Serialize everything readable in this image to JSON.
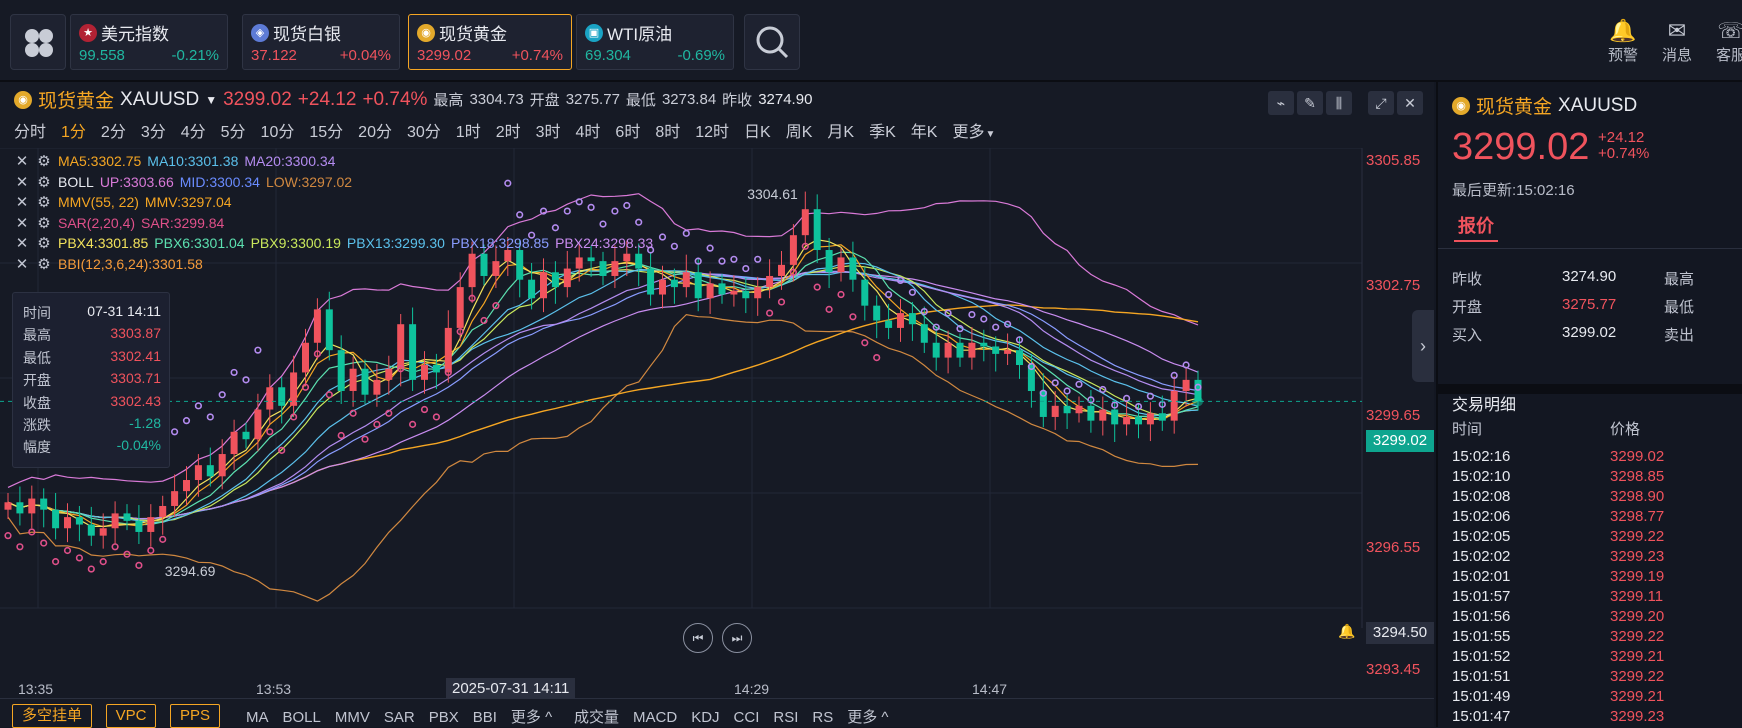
{
  "topbar": {
    "tiles": [
      {
        "name": "美元指数",
        "price": "99.558",
        "change": "-0.21%",
        "dir": "dn",
        "icon": "us-flag-icon"
      },
      {
        "name": "现货白银",
        "price": "37.122",
        "change": "+0.04%",
        "dir": "up",
        "icon": "silver-icon"
      },
      {
        "name": "现货黄金",
        "price": "3299.02",
        "change": "+0.74%",
        "dir": "up",
        "icon": "gold-icon"
      },
      {
        "name": "WTI原油",
        "price": "69.304",
        "change": "-0.69%",
        "dir": "dn",
        "icon": "oil-icon"
      }
    ],
    "tools": [
      {
        "label": "预警"
      },
      {
        "label": "消息"
      },
      {
        "label": "客服"
      }
    ]
  },
  "symbol": {
    "name": "现货黄金",
    "code": "XAUUSD",
    "price": "3299.02",
    "change": "+24.12",
    "pct": "+0.74%",
    "high_label": "最高",
    "high": "3304.73",
    "open_label": "开盘",
    "open": "3275.77",
    "low_label": "最低",
    "low": "3273.84",
    "prev_label": "昨收",
    "prev": "3274.90"
  },
  "periods": [
    "分时",
    "1分",
    "2分",
    "3分",
    "4分",
    "5分",
    "10分",
    "15分",
    "20分",
    "30分",
    "1时",
    "2时",
    "3时",
    "4时",
    "6时",
    "8时",
    "12时",
    "日K",
    "周K",
    "月K",
    "季K",
    "年K",
    "更多"
  ],
  "active_period": "1分",
  "indicators": [
    [
      {
        "t": "MA5:3302.75",
        "c": "#f5a623"
      },
      {
        "t": "MA10:3301.38",
        "c": "#5bc0eb"
      },
      {
        "t": "MA20:3300.34",
        "c": "#b48cf0"
      }
    ],
    [
      {
        "t": "BOLL",
        "c": "#e8eaf0"
      },
      {
        "t": "UP:3303.66",
        "c": "#d97ad8"
      },
      {
        "t": "MID:3300.34",
        "c": "#6a8cff"
      },
      {
        "t": "LOW:3297.02",
        "c": "#d08840"
      }
    ],
    [
      {
        "t": "MMV(55, 22)",
        "c": "#f5a623"
      },
      {
        "t": "MMV:3297.04",
        "c": "#f5a623"
      }
    ],
    [
      {
        "t": "SAR(2,20,4)",
        "c": "#e0508a"
      },
      {
        "t": "SAR:3299.84",
        "c": "#e0508a"
      }
    ],
    [
      {
        "t": "PBX4:3301.85",
        "c": "#f2e25c"
      },
      {
        "t": "PBX6:3301.04",
        "c": "#5ce0b0"
      },
      {
        "t": "PBX9:3300.19",
        "c": "#c9e85c"
      },
      {
        "t": "PBX13:3299.30",
        "c": "#5bc0eb"
      },
      {
        "t": "PBX18:3298.85",
        "c": "#8a9cff"
      },
      {
        "t": "PBX24:3298.33",
        "c": "#c98cf0"
      }
    ],
    [
      {
        "t": "BBI(12,3,6,24):3301.58",
        "c": "#f59b3a"
      }
    ]
  ],
  "tooltip": {
    "rows": [
      {
        "k": "时间",
        "v": "07-31 14:11",
        "c": "#e8eaf0"
      },
      {
        "k": "最高",
        "v": "3303.87",
        "c": "#f0535d"
      },
      {
        "k": "最低",
        "v": "3302.41",
        "c": "#f0535d"
      },
      {
        "k": "开盘",
        "v": "3303.71",
        "c": "#f0535d"
      },
      {
        "k": "收盘",
        "v": "3302.43",
        "c": "#f0535d"
      },
      {
        "k": "涨跌",
        "v": "-1.28",
        "c": "#20b7a1"
      },
      {
        "k": "幅度",
        "v": "-0.04%",
        "c": "#20b7a1"
      }
    ]
  },
  "chart_data": {
    "type": "candlestick",
    "y_ticks": [
      "3305.85",
      "3302.75",
      "3299.65",
      "3296.55",
      "3293.45"
    ],
    "ylim": [
      3293.45,
      3305.85
    ],
    "x_ticks": [
      "13:35",
      "13:53",
      "14:29",
      "14:47"
    ],
    "crosshair_x_label": "2025-07-31 14:11",
    "current_price": "3299.02",
    "crosshair_y_label": "3294.50",
    "high_annotation": "3304.61",
    "low_annotation": "3294.69",
    "close_path": [
      3296.3,
      3296.0,
      3296.4,
      3296.1,
      3295.6,
      3295.9,
      3295.7,
      3295.4,
      3295.6,
      3296.0,
      3295.8,
      3295.5,
      3295.9,
      3296.2,
      3296.6,
      3296.9,
      3297.3,
      3297.0,
      3297.6,
      3298.2,
      3298.0,
      3298.8,
      3299.4,
      3298.9,
      3299.8,
      3300.6,
      3301.5,
      3300.4,
      3299.3,
      3299.9,
      3299.2,
      3299.6,
      3299.9,
      3301.1,
      3299.6,
      3300.0,
      3299.8,
      3301.0,
      3302.1,
      3303.0,
      3302.4,
      3302.8,
      3303.1,
      3302.3,
      3301.8,
      3302.5,
      3302.1,
      3302.6,
      3302.9,
      3302.8,
      3302.4,
      3302.8,
      3303.0,
      3302.6,
      3301.9,
      3302.3,
      3302.1,
      3302.5,
      3301.8,
      3302.2,
      3301.9,
      3302.0,
      3301.8,
      3302.1,
      3302.4,
      3302.7,
      3303.5,
      3304.2,
      3303.1,
      3302.5,
      3302.9,
      3302.3,
      3301.6,
      3301.2,
      3301.0,
      3301.4,
      3301.1,
      3300.6,
      3300.2,
      3300.6,
      3300.2,
      3300.6,
      3300.5,
      3300.3,
      3300.4,
      3300.0,
      3299.3,
      3298.6,
      3298.9,
      3298.7,
      3298.9,
      3298.5,
      3298.8,
      3298.4,
      3298.6,
      3298.4,
      3298.7,
      3298.5,
      3299.3,
      3299.6,
      3299.02
    ]
  },
  "bottom": {
    "btns": [
      "多空挂单",
      "VPC",
      "PPS"
    ],
    "tabs1": [
      "MA",
      "BOLL",
      "MMV",
      "SAR",
      "PBX",
      "BBI",
      "更多 ^"
    ],
    "tabs2": [
      "成交量",
      "MACD",
      "KDJ",
      "CCI",
      "RSI",
      "RS",
      "更多 ^"
    ]
  },
  "right": {
    "name": "现货黄金",
    "code": "XAUUSD",
    "price": "3299.02",
    "change": "+24.12",
    "pct": "+0.74%",
    "updated": "最后更新:15:02:16",
    "tab": "报价",
    "quote": [
      {
        "k": "昨收",
        "v": "3274.90",
        "c": "#e8eaf0",
        "k2": "最高"
      },
      {
        "k": "开盘",
        "v": "3275.77",
        "c": "#f0535d",
        "k2": "最低"
      },
      {
        "k": "买入",
        "v": "3299.02",
        "c": "#e8eaf0",
        "k2": "卖出"
      }
    ],
    "trades_title": "交易明细",
    "col_time": "时间",
    "col_price": "价格",
    "trades": [
      [
        "15:02:16",
        "3299.02"
      ],
      [
        "15:02:10",
        "3298.85"
      ],
      [
        "15:02:08",
        "3298.90"
      ],
      [
        "15:02:06",
        "3298.77"
      ],
      [
        "15:02:05",
        "3299.22"
      ],
      [
        "15:02:02",
        "3299.23"
      ],
      [
        "15:02:01",
        "3299.19"
      ],
      [
        "15:01:57",
        "3299.11"
      ],
      [
        "15:01:56",
        "3299.20"
      ],
      [
        "15:01:55",
        "3299.22"
      ],
      [
        "15:01:52",
        "3299.21"
      ],
      [
        "15:01:51",
        "3299.22"
      ],
      [
        "15:01:49",
        "3299.21"
      ],
      [
        "15:01:47",
        "3299.23"
      ]
    ]
  }
}
